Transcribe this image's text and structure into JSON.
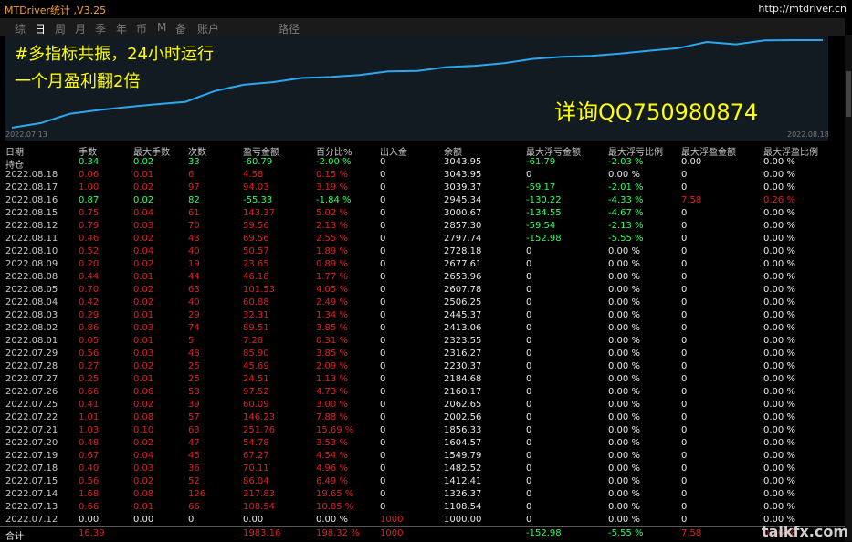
{
  "window": {
    "title": "MTDriver统计 ,V3.25",
    "url": "http://mtdriver.cn"
  },
  "tabs": [
    {
      "label": "综",
      "active": false
    },
    {
      "label": "日",
      "active": true
    },
    {
      "label": "周",
      "active": false
    },
    {
      "label": "月",
      "active": false
    },
    {
      "label": "季",
      "active": false
    },
    {
      "label": "年",
      "active": false
    },
    {
      "label": "币",
      "active": false
    },
    {
      "label": "M",
      "active": false
    },
    {
      "label": "备",
      "active": false
    },
    {
      "label": "账户",
      "active": false
    },
    {
      "label": "路径",
      "active": false
    }
  ],
  "overlay": {
    "line1": "#多指标共振，24小时运行",
    "line2": "一个月盈利翻2倍",
    "line3": "详询QQ750980874"
  },
  "chart_data": {
    "type": "line",
    "x_start_label": "2022.07.13",
    "x_end_label": "2022.08.18",
    "y": [
      1000.0,
      1108.54,
      1326.37,
      1412.41,
      1482.52,
      1549.79,
      1604.57,
      1856.33,
      2002.56,
      2062.65,
      2160.17,
      2184.68,
      2230.37,
      2316.27,
      2323.55,
      2413.06,
      2445.37,
      2506.25,
      2607.78,
      2653.96,
      2677.61,
      2728.18,
      2797.74,
      2857.3,
      3000.67,
      2945.34,
      3039.37,
      3043.95,
      3043.95
    ],
    "color": "#29a8f0"
  },
  "table": {
    "headers": [
      "日期",
      "手数",
      "最大手数",
      "次数",
      "盈亏金额",
      "百分比%",
      "出入金",
      "余额",
      "最大浮亏金额",
      "最大浮亏比例",
      "最大浮盈金额",
      "最大浮盈比例"
    ],
    "rows": [
      [
        "持仓",
        "0.34",
        "0.02",
        "33",
        "-60.79",
        "-2.00 %",
        "0",
        "3043.95",
        "-61.79",
        "-2.03 %",
        "0.00",
        "0.00 %"
      ],
      [
        "2022.08.18",
        "0.06",
        "0.01",
        "6",
        "4.58",
        "0.15 %",
        "0",
        "3043.95",
        "0",
        "0.00 %",
        "0",
        "0.00 %"
      ],
      [
        "2022.08.17",
        "1.00",
        "0.02",
        "97",
        "94.03",
        "3.19 %",
        "0",
        "3039.37",
        "-59.17",
        "-2.01 %",
        "0",
        "0.00 %"
      ],
      [
        "2022.08.16",
        "0.87",
        "0.02",
        "82",
        "-55.33",
        "-1.84 %",
        "0",
        "2945.34",
        "-130.22",
        "-4.33 %",
        "7.58",
        "0.26 %"
      ],
      [
        "2022.08.15",
        "0.75",
        "0.04",
        "61",
        "143.37",
        "5.02 %",
        "0",
        "3000.67",
        "-134.55",
        "-4.67 %",
        "0",
        "0.00 %"
      ],
      [
        "2022.08.12",
        "0.79",
        "0.03",
        "70",
        "59.56",
        "2.13 %",
        "0",
        "2857.30",
        "-59.54",
        "-2.13 %",
        "0",
        "0.00 %"
      ],
      [
        "2022.08.11",
        "0.46",
        "0.02",
        "43",
        "69.56",
        "2.55 %",
        "0",
        "2797.74",
        "-152.98",
        "-5.55 %",
        "0",
        "0.00 %"
      ],
      [
        "2022.08.10",
        "0.52",
        "0.04",
        "40",
        "50.57",
        "1.89 %",
        "0",
        "2728.18",
        "0",
        "0.00 %",
        "0",
        "0.00 %"
      ],
      [
        "2022.08.09",
        "0.20",
        "0.02",
        "19",
        "23.65",
        "0.89 %",
        "0",
        "2677.61",
        "0",
        "0.00 %",
        "0",
        "0.00 %"
      ],
      [
        "2022.08.08",
        "0.44",
        "0.01",
        "44",
        "46.18",
        "1.77 %",
        "0",
        "2653.96",
        "0",
        "0.00 %",
        "0",
        "0.00 %"
      ],
      [
        "2022.08.05",
        "0.70",
        "0.02",
        "63",
        "101.53",
        "4.05 %",
        "0",
        "2607.78",
        "0",
        "0.00 %",
        "0",
        "0.00 %"
      ],
      [
        "2022.08.04",
        "0.42",
        "0.02",
        "40",
        "60.88",
        "2.49 %",
        "0",
        "2506.25",
        "0",
        "0.00 %",
        "0",
        "0.00 %"
      ],
      [
        "2022.08.03",
        "0.29",
        "0.01",
        "29",
        "32.31",
        "1.34 %",
        "0",
        "2445.37",
        "0",
        "0.00 %",
        "0",
        "0.00 %"
      ],
      [
        "2022.08.02",
        "0.86",
        "0.03",
        "74",
        "89.51",
        "3.85 %",
        "0",
        "2413.06",
        "0",
        "0.00 %",
        "0",
        "0.00 %"
      ],
      [
        "2022.08.01",
        "0.05",
        "0.01",
        "5",
        "7.28",
        "0.31 %",
        "0",
        "2323.55",
        "0",
        "0.00 %",
        "0",
        "0.00 %"
      ],
      [
        "2022.07.29",
        "0.56",
        "0.03",
        "48",
        "85.90",
        "3.85 %",
        "0",
        "2316.27",
        "0",
        "0.00 %",
        "0",
        "0.00 %"
      ],
      [
        "2022.07.28",
        "0.27",
        "0.02",
        "25",
        "45.69",
        "2.09 %",
        "0",
        "2230.37",
        "0",
        "0.00 %",
        "0",
        "0.00 %"
      ],
      [
        "2022.07.27",
        "0.25",
        "0.01",
        "25",
        "24.51",
        "1.13 %",
        "0",
        "2184.68",
        "0",
        "0.00 %",
        "0",
        "0.00 %"
      ],
      [
        "2022.07.26",
        "0.66",
        "0.06",
        "53",
        "97.52",
        "4.73 %",
        "0",
        "2160.17",
        "0",
        "0.00 %",
        "0",
        "0.00 %"
      ],
      [
        "2022.07.25",
        "0.41",
        "0.02",
        "39",
        "60.09",
        "3.00 %",
        "0",
        "2062.65",
        "0",
        "0.00 %",
        "0",
        "0.00 %"
      ],
      [
        "2022.07.22",
        "1.01",
        "0.08",
        "57",
        "146.23",
        "7.88 %",
        "0",
        "2002.56",
        "0",
        "0.00 %",
        "0",
        "0.00 %"
      ],
      [
        "2022.07.21",
        "1.03",
        "0.10",
        "63",
        "251.76",
        "15.69 %",
        "0",
        "1856.33",
        "0",
        "0.00 %",
        "0",
        "0.00 %"
      ],
      [
        "2022.07.20",
        "0.48",
        "0.02",
        "47",
        "54.78",
        "3.53 %",
        "0",
        "1604.57",
        "0",
        "0.00 %",
        "0",
        "0.00 %"
      ],
      [
        "2022.07.19",
        "0.67",
        "0.04",
        "45",
        "67.27",
        "4.54 %",
        "0",
        "1549.79",
        "0",
        "0.00 %",
        "0",
        "0.00 %"
      ],
      [
        "2022.07.18",
        "0.40",
        "0.03",
        "36",
        "70.11",
        "4.96 %",
        "0",
        "1482.52",
        "0",
        "0.00 %",
        "0",
        "0.00 %"
      ],
      [
        "2022.07.15",
        "0.56",
        "0.02",
        "52",
        "86.04",
        "6.49 %",
        "0",
        "1412.41",
        "0",
        "0.00 %",
        "0",
        "0.00 %"
      ],
      [
        "2022.07.14",
        "1.68",
        "0.08",
        "126",
        "217.83",
        "19.65 %",
        "0",
        "1326.37",
        "0",
        "0.00 %",
        "0",
        "0.00 %"
      ],
      [
        "2022.07.13",
        "0.66",
        "0.01",
        "66",
        "108.54",
        "10.85 %",
        "0",
        "1108.54",
        "0",
        "0.00 %",
        "0",
        "0.00 %"
      ],
      [
        "2022.07.12",
        "0.00",
        "0.00",
        "0",
        "0.00",
        "0.00 %",
        "1000",
        "1000.00",
        "0",
        "0.00 %",
        "0",
        "0.00 %"
      ]
    ],
    "total": [
      "合计",
      "16.39",
      "",
      "",
      "1983.16",
      "198.32 %",
      "1000",
      "",
      "-152.98",
      "-5.55 %",
      "7.58",
      "0.26 %"
    ]
  },
  "watermark": "talkfx.com",
  "colors": {
    "profit": "#e02020",
    "loss": "#30ff60",
    "neutral": "#e8e8e8",
    "title": "#f0a030"
  }
}
